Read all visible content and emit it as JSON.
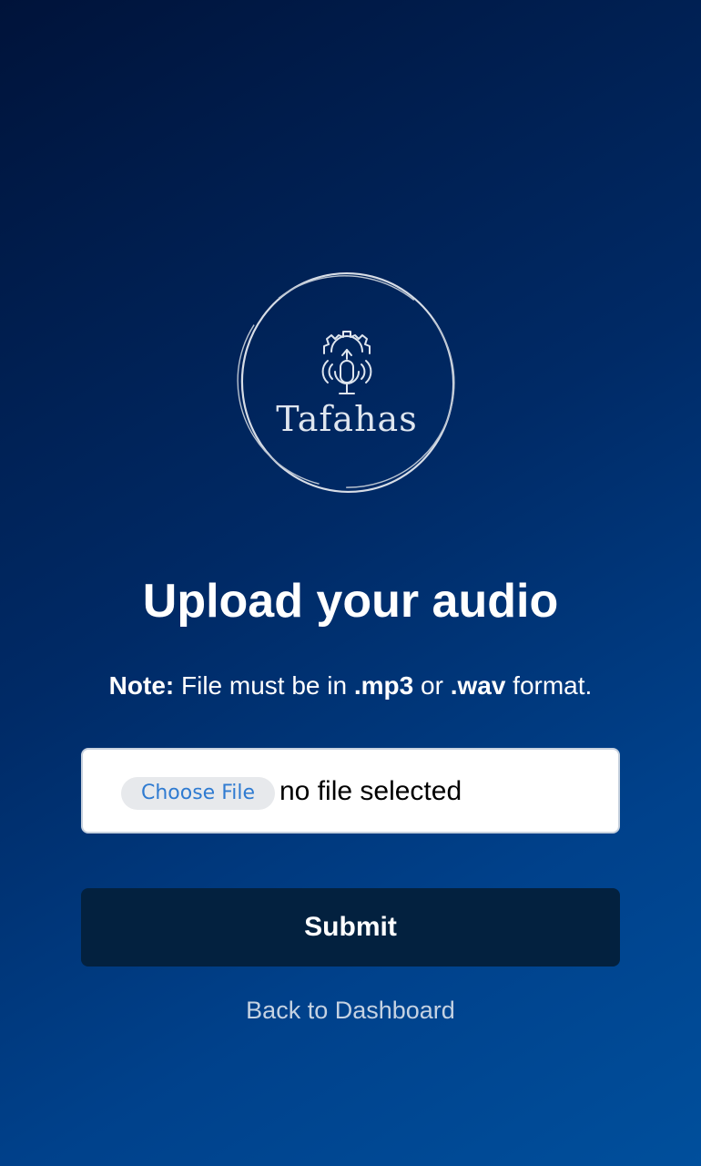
{
  "logo": {
    "text": "Tafahas",
    "icon": "microphone-gear-icon"
  },
  "title": "Upload your audio",
  "note": {
    "label": "Note:",
    "text_before": " File must be in ",
    "format1": ".mp3",
    "text_middle": " or ",
    "format2": ".wav",
    "text_after": " format."
  },
  "file_input": {
    "button_label": "Choose File",
    "status": "no file selected"
  },
  "submit_label": "Submit",
  "back_link": "Back to Dashboard",
  "colors": {
    "background_top": "#00133a",
    "background_bottom": "#004f9c",
    "submit_bg": "#03213f",
    "choose_file_text": "#2f7bd1"
  }
}
